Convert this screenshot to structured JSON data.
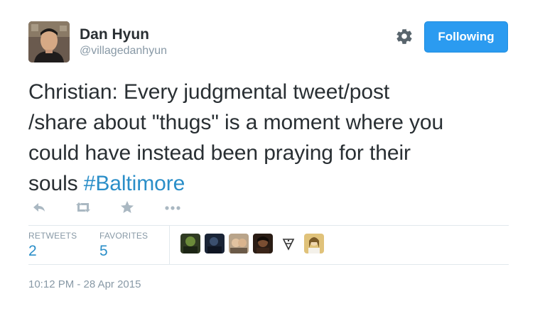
{
  "author": {
    "name": "Dan Hyun",
    "handle": "@villagedanhyun"
  },
  "follow_button": {
    "label": "Following"
  },
  "tweet": {
    "lines": [
      "Christian: Every judgmental tweet/post",
      "/share about \"thugs\" is a moment where you",
      "could have instead been praying for their",
      "souls "
    ],
    "hashtag": "#Baltimore"
  },
  "actions": [
    "reply-icon",
    "retweet-icon",
    "favorite-star-icon",
    "more-options-icon"
  ],
  "stats": {
    "retweets_label": "RETWEETS",
    "retweets_value": "2",
    "favorites_label": "FAVORITES",
    "favorites_value": "5"
  },
  "timestamp": "10:12 PM - 28 Apr 2015",
  "colors": {
    "accent": "#2b9bf0",
    "link": "#2a8ec8",
    "muted": "#8899a6",
    "text": "#292f33"
  }
}
